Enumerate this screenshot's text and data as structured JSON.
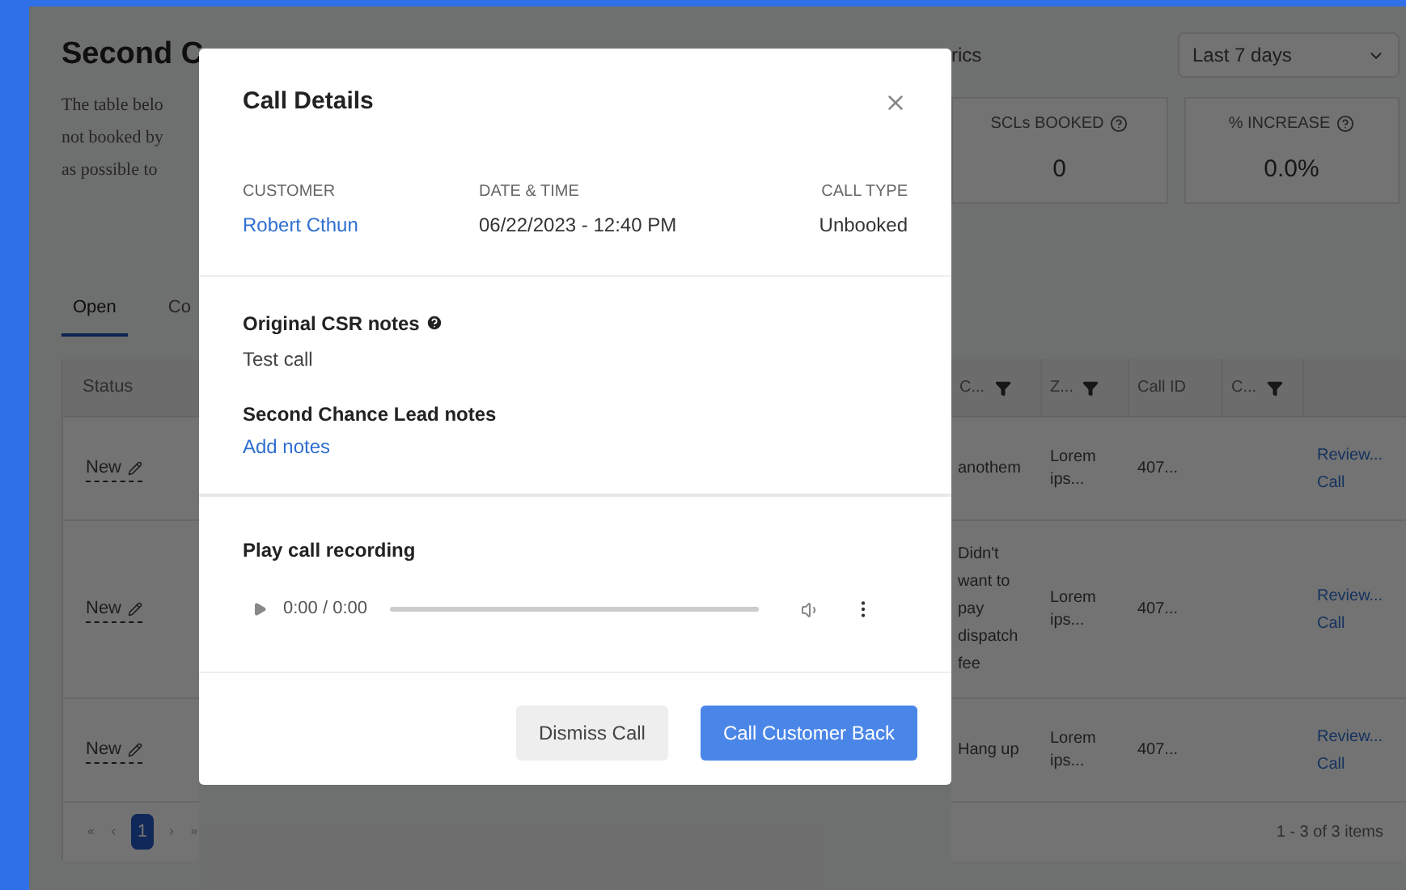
{
  "page": {
    "heading": "Second C",
    "description_lines": [
      "The table belo",
      "not booked by",
      "as possible to"
    ],
    "metrics_label": "rics",
    "date_range": "Last 7 days",
    "stats": [
      {
        "label": "SCLs BOOKED",
        "value": "0"
      },
      {
        "label": "% INCREASE",
        "value": "0.0%"
      }
    ],
    "tabs": [
      {
        "label": "Open",
        "selected": true
      },
      {
        "label": "Co",
        "selected": false
      }
    ],
    "table": {
      "left_columns": [
        "Status"
      ],
      "right_columns": [
        {
          "label": "C...",
          "filter": true
        },
        {
          "label": "Z...",
          "filter": true
        },
        {
          "label": "Call ID",
          "filter": false
        },
        {
          "label": "C...",
          "filter": true
        }
      ],
      "rows": [
        {
          "status": "New",
          "reason": "anothem",
          "zip": "Lorem ips...",
          "call_id": "407...",
          "action": [
            "Review...",
            "Call"
          ]
        },
        {
          "status": "New",
          "reason": "Didn't want to pay dispatch fee",
          "zip": "Lorem ips...",
          "call_id": "407...",
          "action": [
            "Review...",
            "Call"
          ]
        },
        {
          "status": "New",
          "reason": "Hang up",
          "zip": "Lorem ips...",
          "call_id": "407...",
          "action": [
            "Review...",
            "Call"
          ]
        }
      ]
    },
    "pagination": {
      "pages": [
        {
          "label": "1",
          "selected": true
        }
      ],
      "summary": "1 - 3 of 3 items"
    }
  },
  "modal": {
    "title": "Call Details",
    "fields": [
      {
        "label": "CUSTOMER",
        "value": "Robert Cthun",
        "kind": "link"
      },
      {
        "label": "DATE & TIME",
        "value": "06/22/2023 - 12:40 PM",
        "kind": "text"
      },
      {
        "label": "CALL TYPE",
        "value": "Unbooked",
        "kind": "text"
      }
    ],
    "csr_notes_label": "Original CSR notes",
    "csr_notes": "Test call",
    "scl_notes_label": "Second Chance Lead notes",
    "add_notes": "Add notes",
    "recording_label": "Play call recording",
    "player_time": "0:00 / 0:00",
    "buttons": [
      {
        "label": "Dismiss Call",
        "kind": "secondary"
      },
      {
        "label": "Call Customer Back",
        "kind": "primary"
      }
    ]
  }
}
